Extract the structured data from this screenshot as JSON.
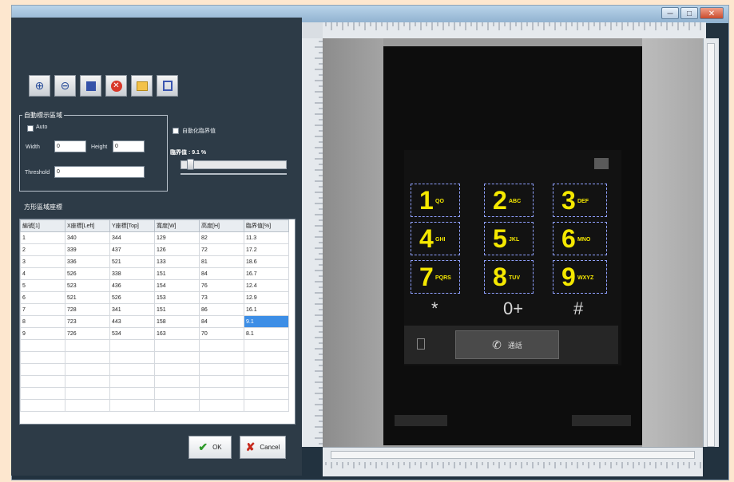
{
  "window": {
    "minimize_label": "─",
    "maximize_label": "□",
    "close_label": "✕"
  },
  "toolbar": {
    "buttons": [
      {
        "name": "zoom-in",
        "icon": "zoom-in-icon",
        "glyph": "🔍"
      },
      {
        "name": "zoom-out",
        "icon": "zoom-out-icon",
        "glyph": "🔍"
      },
      {
        "name": "fit",
        "icon": "square-icon",
        "glyph": "■"
      },
      {
        "name": "delete",
        "icon": "delete-icon",
        "glyph": "⊗"
      },
      {
        "name": "open",
        "icon": "open-icon",
        "glyph": "📂"
      },
      {
        "name": "save",
        "icon": "save-icon",
        "glyph": "💾"
      }
    ]
  },
  "auto_group": {
    "legend": "自動標示區域",
    "auto_label": "Auto",
    "width_label": "Width",
    "width_value": "0",
    "height_label": "Height",
    "height_value": "0",
    "threshold_label": "Threshold",
    "threshold_value": "0"
  },
  "threshold_option": {
    "checkbox_label": "自動化臨界值",
    "value_label": "臨界值 : 9.1 %",
    "slider_fraction": 0.05
  },
  "table_section": {
    "title": "方形區域座標"
  },
  "table": {
    "headers": [
      "編號[1]",
      "X座標[Left]",
      "Y座標[Top]",
      "寬度[W]",
      "高度[H]",
      "臨界值[%]"
    ],
    "rows": [
      [
        "1",
        "340",
        "344",
        "129",
        "82",
        "11.3"
      ],
      [
        "2",
        "339",
        "437",
        "126",
        "72",
        "17.2"
      ],
      [
        "3",
        "336",
        "521",
        "133",
        "81",
        "18.6"
      ],
      [
        "4",
        "526",
        "338",
        "151",
        "84",
        "16.7"
      ],
      [
        "5",
        "523",
        "436",
        "154",
        "76",
        "12.4"
      ],
      [
        "6",
        "521",
        "526",
        "153",
        "73",
        "12.9"
      ],
      [
        "7",
        "728",
        "341",
        "151",
        "86",
        "16.1"
      ],
      [
        "8",
        "723",
        "443",
        "158",
        "84",
        "9.1"
      ],
      [
        "9",
        "726",
        "534",
        "163",
        "70",
        "8.1"
      ]
    ],
    "selected_row": 7
  },
  "buttons": {
    "ok_label": "OK",
    "cancel_label": "Cancel",
    "ok_color": "#2e9a2a",
    "cancel_color": "#c6281c"
  },
  "phone": {
    "keys": [
      {
        "digit": "1",
        "letters": "QO"
      },
      {
        "digit": "2",
        "letters": "ABC"
      },
      {
        "digit": "3",
        "letters": "DEF"
      },
      {
        "digit": "4",
        "letters": "GHI"
      },
      {
        "digit": "5",
        "letters": "JKL"
      },
      {
        "digit": "6",
        "letters": "MNO"
      },
      {
        "digit": "7",
        "letters": "PQRS"
      },
      {
        "digit": "8",
        "letters": "TUV"
      },
      {
        "digit": "9",
        "letters": "WXYZ"
      }
    ],
    "star": "*",
    "zero": "0+",
    "hash": "#",
    "call_label": "通話",
    "key_color": "#f5e800"
  }
}
